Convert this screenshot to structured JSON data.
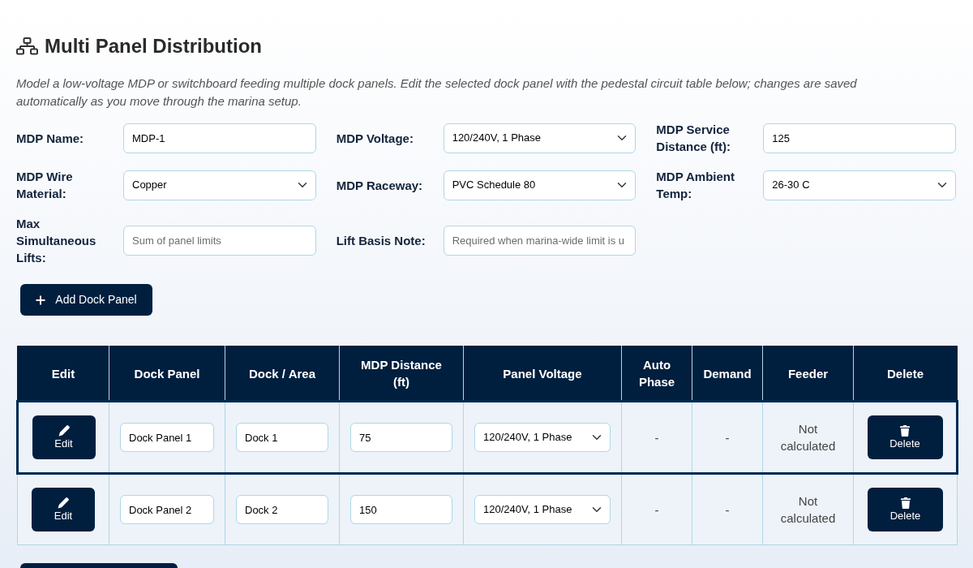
{
  "header": {
    "title": "Multi Panel Distribution",
    "description": "Model a low-voltage MDP or switchboard feeding multiple dock panels. Edit the selected dock panel with the pedestal circuit table below; changes are saved automatically as you move through the marina setup."
  },
  "form_fields": [
    {
      "label": "MDP Name:",
      "kind": "text",
      "value": "MDP-1"
    },
    {
      "label": "MDP Voltage:",
      "kind": "select",
      "value": "120/240V, 1 Phase"
    },
    {
      "label": "MDP Service Distance (ft):",
      "kind": "text",
      "value": "125"
    },
    {
      "label": "MDP Wire Material:",
      "kind": "select",
      "value": "Copper"
    },
    {
      "label": "MDP Raceway:",
      "kind": "select",
      "value": "PVC Schedule 80"
    },
    {
      "label": "MDP Ambient Temp:",
      "kind": "select",
      "value": "26-30 C"
    },
    {
      "label": "Max Simultaneous Lifts:",
      "kind": "text",
      "placeholder": "Sum of panel limits"
    },
    {
      "label": "Lift Basis Note:",
      "kind": "text",
      "placeholder": "Required when marina-wide limit is u"
    }
  ],
  "add_button": {
    "label": "Add Dock Panel"
  },
  "table": {
    "columns": [
      "Edit",
      "Dock Panel",
      "Dock / Area",
      "MDP Distance (ft)",
      "Panel Voltage",
      "Auto Phase",
      "Demand",
      "Feeder",
      "Delete"
    ],
    "rows": [
      {
        "selected": true,
        "edit_label": "Edit",
        "dock_panel": "Dock Panel 1",
        "dock_area": "Dock 1",
        "mdp_distance": "75",
        "panel_voltage": "120/240V, 1 Phase",
        "auto_phase": "-",
        "demand": "-",
        "feeder": "Not calculated",
        "delete_label": "Delete"
      },
      {
        "selected": false,
        "edit_label": "Edit",
        "dock_panel": "Dock Panel 2",
        "dock_area": "Dock 2",
        "mdp_distance": "150",
        "panel_voltage": "120/240V, 1 Phase",
        "auto_phase": "-",
        "demand": "-",
        "feeder": "Not calculated",
        "delete_label": "Delete"
      }
    ]
  }
}
